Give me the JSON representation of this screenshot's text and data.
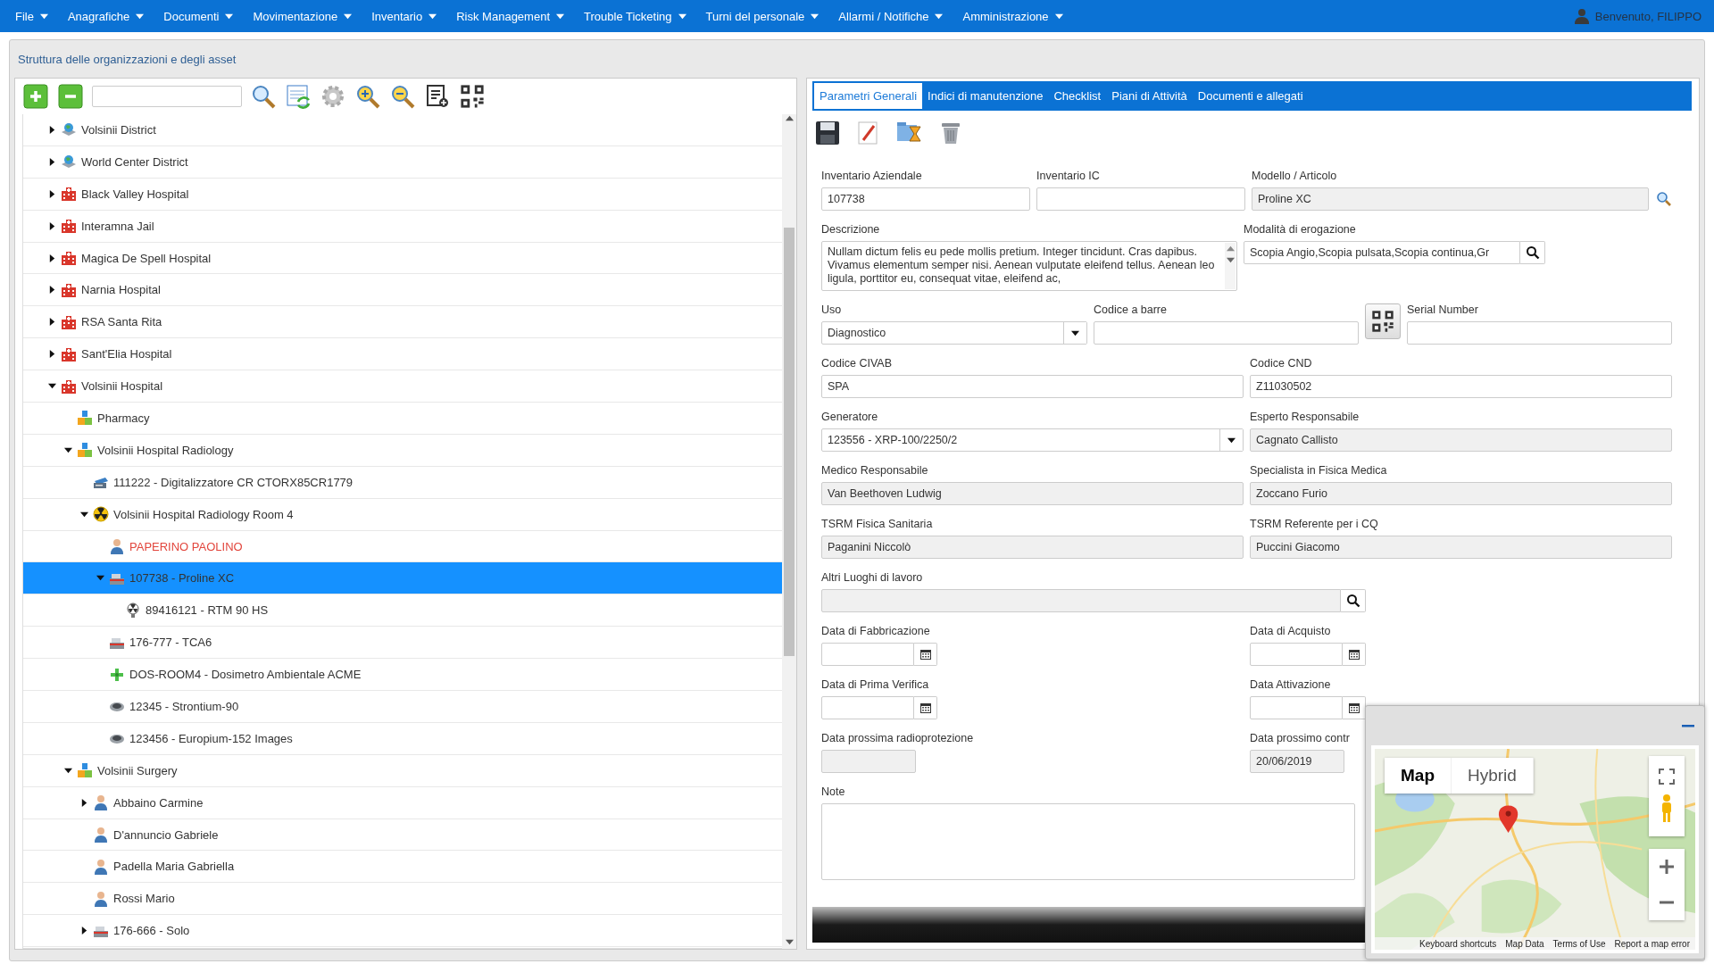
{
  "menu": [
    {
      "label": "File"
    },
    {
      "label": "Anagrafiche"
    },
    {
      "label": "Documenti"
    },
    {
      "label": "Movimentazione"
    },
    {
      "label": "Inventario"
    },
    {
      "label": "Risk Management"
    },
    {
      "label": "Trouble Ticketing"
    },
    {
      "label": "Turni del personale"
    },
    {
      "label": "Allarmi / Notifiche"
    },
    {
      "label": "Amministrazione"
    }
  ],
  "user": {
    "greeting": "Benvenuto, FILIPPO"
  },
  "page_title": "Struttura delle organizzazioni e degli asset",
  "tree": [
    {
      "label": "Volsinii District",
      "kind": "district",
      "selected": false,
      "alert": false,
      "expanded": false
    },
    {
      "label": "World Center District",
      "kind": "district",
      "selected": false,
      "alert": false,
      "expanded": false
    },
    {
      "label": "Black Valley Hospital",
      "kind": "hospital",
      "selected": false,
      "alert": false,
      "expanded": false
    },
    {
      "label": "Interamna Jail",
      "kind": "hospital",
      "selected": false,
      "alert": false,
      "expanded": false
    },
    {
      "label": "Magica De Spell Hospital",
      "kind": "hospital",
      "selected": false,
      "alert": false,
      "expanded": false
    },
    {
      "label": "Narnia Hospital",
      "kind": "hospital",
      "selected": false,
      "alert": false,
      "expanded": false
    },
    {
      "label": "RSA Santa Rita",
      "kind": "hospital",
      "selected": false,
      "alert": false,
      "expanded": false
    },
    {
      "label": "Sant'Elia Hospital",
      "kind": "hospital",
      "selected": false,
      "alert": false,
      "expanded": false
    },
    {
      "label": "Volsinii Hospital",
      "kind": "hospital",
      "selected": false,
      "alert": false,
      "expanded": true,
      "children": [
        {
          "label": "Pharmacy",
          "kind": "department",
          "selected": false,
          "alert": false
        },
        {
          "label": "Volsinii Hospital Radiology",
          "kind": "department",
          "selected": false,
          "alert": false,
          "expanded": true,
          "children": [
            {
              "label": "111222 - Digitalizzatore CR CTORX85CR1779",
              "kind": "scanner",
              "selected": false,
              "alert": false
            },
            {
              "label": "Volsinii Hospital Radiology Room 4",
              "kind": "radiation",
              "selected": false,
              "alert": false,
              "expanded": true,
              "children": [
                {
                  "label": "PAPERINO PAOLINO",
                  "kind": "person",
                  "selected": false,
                  "alert": true
                },
                {
                  "label": "107738 - Proline XC",
                  "kind": "equipment",
                  "selected": true,
                  "alert": false,
                  "expanded": true,
                  "children": [
                    {
                      "label": "89416121 - RTM 90 HS",
                      "kind": "source",
                      "selected": false,
                      "alert": false
                    }
                  ]
                },
                {
                  "label": "176-777 - TCA6",
                  "kind": "equipment",
                  "selected": false,
                  "alert": false
                },
                {
                  "label": "DOS-ROOM4 - Dosimetro Ambientale ACME",
                  "kind": "dosimeter",
                  "selected": false,
                  "alert": false
                },
                {
                  "label": "12345 - Strontium-90",
                  "kind": "disc",
                  "selected": false,
                  "alert": false
                },
                {
                  "label": "123456 - Europium-152 Images",
                  "kind": "disc",
                  "selected": false,
                  "alert": false
                }
              ]
            }
          ]
        },
        {
          "label": "Volsinii Surgery",
          "kind": "department",
          "selected": false,
          "alert": false,
          "expanded": true,
          "children": [
            {
              "label": "Abbaino Carmine",
              "kind": "person",
              "selected": false,
              "alert": false,
              "expanded": false
            },
            {
              "label": "D'annuncio Gabriele",
              "kind": "person",
              "selected": false,
              "alert": false
            },
            {
              "label": "Padella Maria Gabriella",
              "kind": "person",
              "selected": false,
              "alert": false
            },
            {
              "label": "Rossi Mario",
              "kind": "person",
              "selected": false,
              "alert": false
            },
            {
              "label": "176-666 - Solo",
              "kind": "equipment",
              "selected": false,
              "alert": false,
              "expanded": false
            }
          ]
        }
      ]
    }
  ],
  "tabs": [
    {
      "label": "Parametri Generali",
      "selected": true
    },
    {
      "label": "Indici di manutenzione",
      "selected": false
    },
    {
      "label": "Checklist",
      "selected": false
    },
    {
      "label": "Piani di Attività",
      "selected": false
    },
    {
      "label": "Documenti e allegati",
      "selected": false
    }
  ],
  "form_rows": [
    [
      {
        "kind": "text",
        "label": "Inventario Aziendale",
        "value": "107738",
        "disabled": false
      },
      {
        "kind": "text",
        "label": "Inventario IC",
        "disabled": false
      },
      {
        "kind": "lookup",
        "label": "Modello / Articolo",
        "value": "Proline XC",
        "disabled": true
      }
    ],
    [
      {
        "kind": "textarea",
        "label": "Descrizione",
        "value": "Nullam dictum felis eu pede mollis pretium. Integer tincidunt. Cras dapibus. Vivamus elementum semper nisi. Aenean vulputate eleifend tellus. Aenean leo ligula, porttitor eu, consequat vitae, eleifend ac,",
        "disabled": false
      },
      {
        "kind": "search",
        "label": "Modalità di erogazione",
        "value": "Scopia Angio,Scopia pulsata,Scopia continua,Gr",
        "disabled": false
      }
    ],
    [
      {
        "kind": "select",
        "label": "Uso",
        "value": "Diagnostico"
      },
      {
        "kind": "text",
        "label": "Codice a barre",
        "disabled": false
      },
      {
        "kind": "qr-button"
      },
      {
        "kind": "text",
        "label": "Serial Number",
        "disabled": false
      }
    ],
    [
      {
        "kind": "text",
        "label": "Codice CIVAB",
        "value": "SPA",
        "disabled": false
      },
      {
        "kind": "text",
        "label": "Codice CND",
        "value": "Z11030502",
        "disabled": false
      }
    ],
    [
      {
        "kind": "select",
        "label": "Generatore",
        "value": "123556 - XRP-100/2250/2"
      },
      {
        "kind": "text",
        "label": "Esperto Responsabile",
        "value": "Cagnato Callisto",
        "disabled": true
      }
    ],
    [
      {
        "kind": "text",
        "label": "Medico Responsabile",
        "value": "Van Beethoven Ludwig",
        "disabled": true
      },
      {
        "kind": "text",
        "label": "Specialista in Fisica Medica",
        "value": "Zoccano Furio",
        "disabled": true
      }
    ],
    [
      {
        "kind": "text",
        "label": "TSRM Fisica Sanitaria",
        "value": "Paganini Niccolò",
        "disabled": true
      },
      {
        "kind": "text",
        "label": "TSRM Referente per i CQ",
        "value": "Puccini Giacomo",
        "disabled": true
      }
    ],
    [
      {
        "kind": "search",
        "label": "Altri Luoghi di lavoro",
        "disabled": true
      }
    ],
    [
      {
        "kind": "date",
        "label": "Data di Fabbricazione"
      },
      {
        "kind": "date",
        "label": "Data di Acquisto"
      }
    ],
    [
      {
        "kind": "date",
        "label": "Data di Prima Verifica"
      },
      {
        "kind": "date",
        "label": "Data Attivazione"
      }
    ],
    [
      {
        "kind": "short",
        "label": "Data prossima radioprotezione",
        "disabled": true
      },
      {
        "kind": "short",
        "label": "Data prossimo contr",
        "value": "20/06/2019",
        "disabled": true
      }
    ],
    [
      {
        "kind": "note",
        "label": "Note",
        "disabled": false
      }
    ]
  ],
  "map_window": {
    "map_types": [
      {
        "label": "Map",
        "selected": true
      },
      {
        "label": "Hybrid",
        "selected": false
      }
    ],
    "footer": [
      "Keyboard shortcuts",
      "Map Data",
      "Terms of Use",
      "Report a map error"
    ]
  }
}
